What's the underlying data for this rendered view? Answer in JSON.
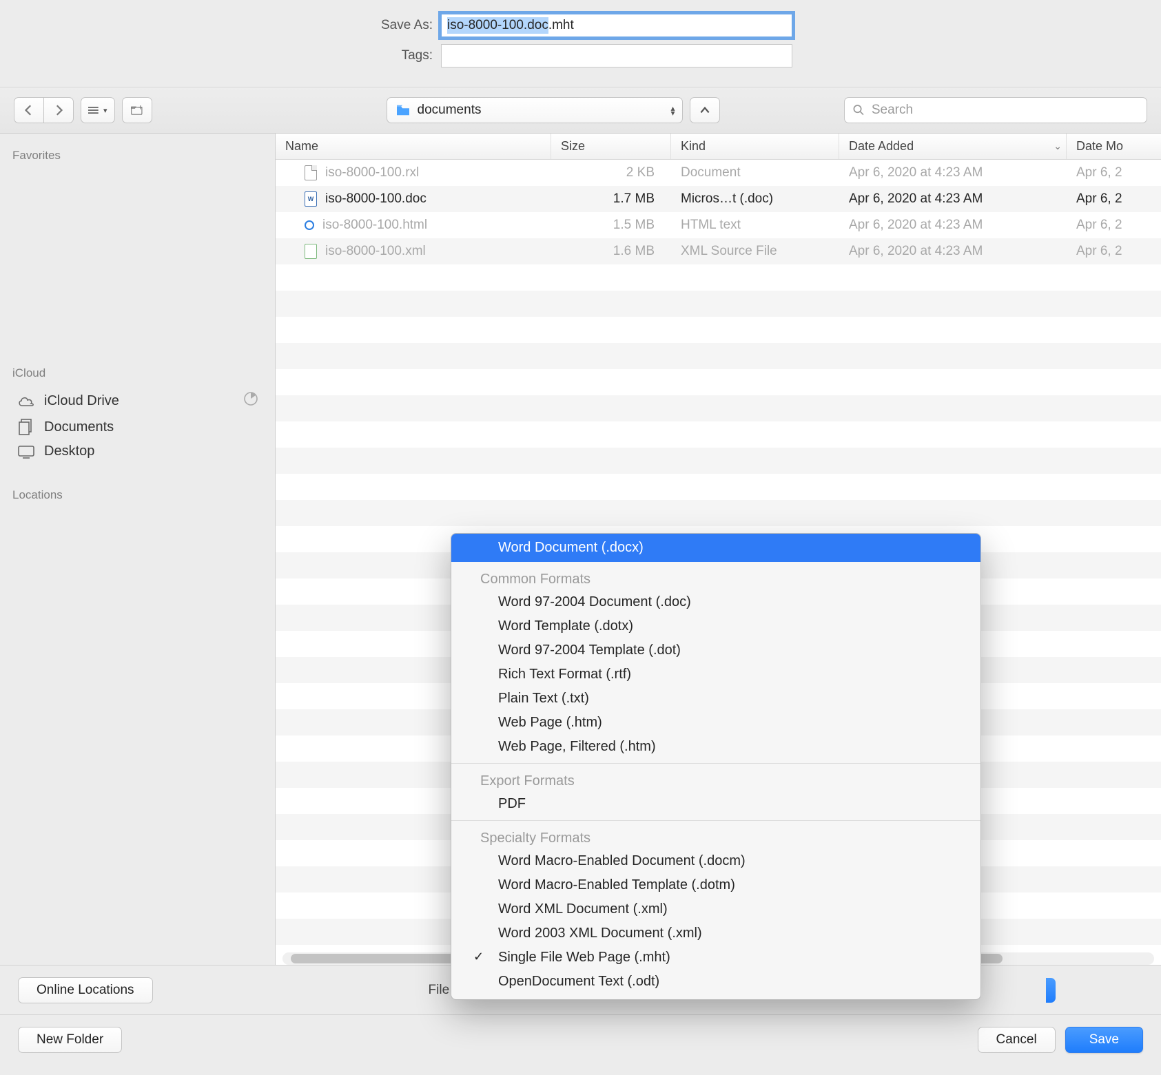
{
  "save_as_label": "Save As:",
  "tags_label": "Tags:",
  "filename_prefix": "iso-8000-100.doc",
  "filename_suffix": ".mht",
  "location": "documents",
  "search_placeholder": "Search",
  "sidebar": {
    "favorites_heading": "Favorites",
    "icloud_heading": "iCloud",
    "icloud_drive": "iCloud Drive",
    "documents": "Documents",
    "desktop": "Desktop",
    "locations_heading": "Locations"
  },
  "columns": {
    "name": "Name",
    "size": "Size",
    "kind": "Kind",
    "date_added": "Date Added",
    "date_modified": "Date Mo"
  },
  "files": [
    {
      "name": "iso-8000-100.rxl",
      "size": "2 KB",
      "kind": "Document",
      "date_added": "Apr 6, 2020 at 4:23 AM",
      "date_modified": "Apr 6, 2",
      "dim": true,
      "icon": "blank"
    },
    {
      "name": "iso-8000-100.doc",
      "size": "1.7 MB",
      "kind": "Micros…t (.doc)",
      "date_added": "Apr 6, 2020 at 4:23 AM",
      "date_modified": "Apr 6, 2",
      "dim": false,
      "icon": "word"
    },
    {
      "name": "iso-8000-100.html",
      "size": "1.5 MB",
      "kind": "HTML text",
      "date_added": "Apr 6, 2020 at 4:23 AM",
      "date_modified": "Apr 6, 2",
      "dim": true,
      "icon": "html"
    },
    {
      "name": "iso-8000-100.xml",
      "size": "1.6 MB",
      "kind": "XML Source File",
      "date_added": "Apr 6, 2020 at 4:23 AM",
      "date_modified": "Apr 6, 2",
      "dim": true,
      "icon": "xml"
    }
  ],
  "menu": {
    "highlight": "Word Document (.docx)",
    "section_common": "Common Formats",
    "common": [
      "Word 97-2004 Document (.doc)",
      "Word Template (.dotx)",
      "Word 97-2004 Template (.dot)",
      "Rich Text Format (.rtf)",
      "Plain Text (.txt)",
      "Web Page (.htm)",
      "Web Page, Filtered (.htm)"
    ],
    "section_export": "Export Formats",
    "export": [
      "PDF"
    ],
    "section_specialty": "Specialty Formats",
    "specialty": [
      "Word Macro-Enabled Document (.docm)",
      "Word Macro-Enabled Template (.dotm)",
      "Word XML Document (.xml)",
      "Word 2003 XML Document (.xml)",
      "Single File Web Page (.mht)",
      "OpenDocument Text (.odt)"
    ],
    "checked": "Single File Web Page (.mht)"
  },
  "bottom": {
    "online_locations": "Online Locations",
    "file_format": "File Format",
    "new_folder": "New Folder",
    "cancel": "Cancel",
    "save": "Save"
  }
}
